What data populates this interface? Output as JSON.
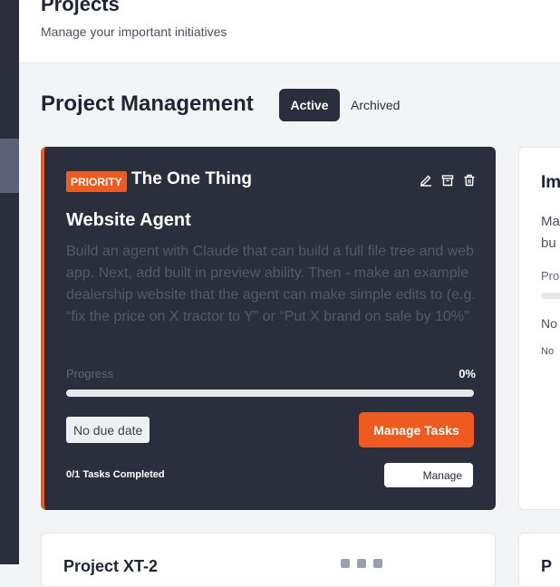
{
  "header": {
    "title": "Projects",
    "subtitle": "Manage your important initiatives"
  },
  "section": {
    "title": "Project Management",
    "filters": {
      "active": "Active",
      "archived": "Archived"
    }
  },
  "main_card": {
    "badge": "PRIORITY",
    "heading": "The One Thing",
    "project_name": "Website Agent",
    "description": "Build an agent with Claude that can build a full file tree and web app. Next, add built in preview ability. Then - make an example dealership website that the agent can make simple edits to (e.g. “fix the price on X tractor to Y” or “Put X brand on sale by 10%”",
    "progress_label": "Progress",
    "progress_percent": "0%",
    "progress_value": 0,
    "due_date": "No due date",
    "manage_tasks_label": "Manage Tasks",
    "tasks_completed": "0/1 Tasks Completed",
    "manage_label": "Manage",
    "icons": [
      "edit-icon",
      "archive-icon",
      "trash-icon"
    ]
  },
  "right_card": {
    "title": "Im",
    "desc_line1": "Ma",
    "desc_line2": "bu",
    "progress_label": "Pro",
    "due": "No",
    "tasks": "No"
  },
  "bottom_left_card": {
    "title": "Project XT-2"
  },
  "bottom_right_card": {
    "title": "P"
  },
  "colors": {
    "accent": "#ee5a1f",
    "dark": "#2a2e3d"
  }
}
